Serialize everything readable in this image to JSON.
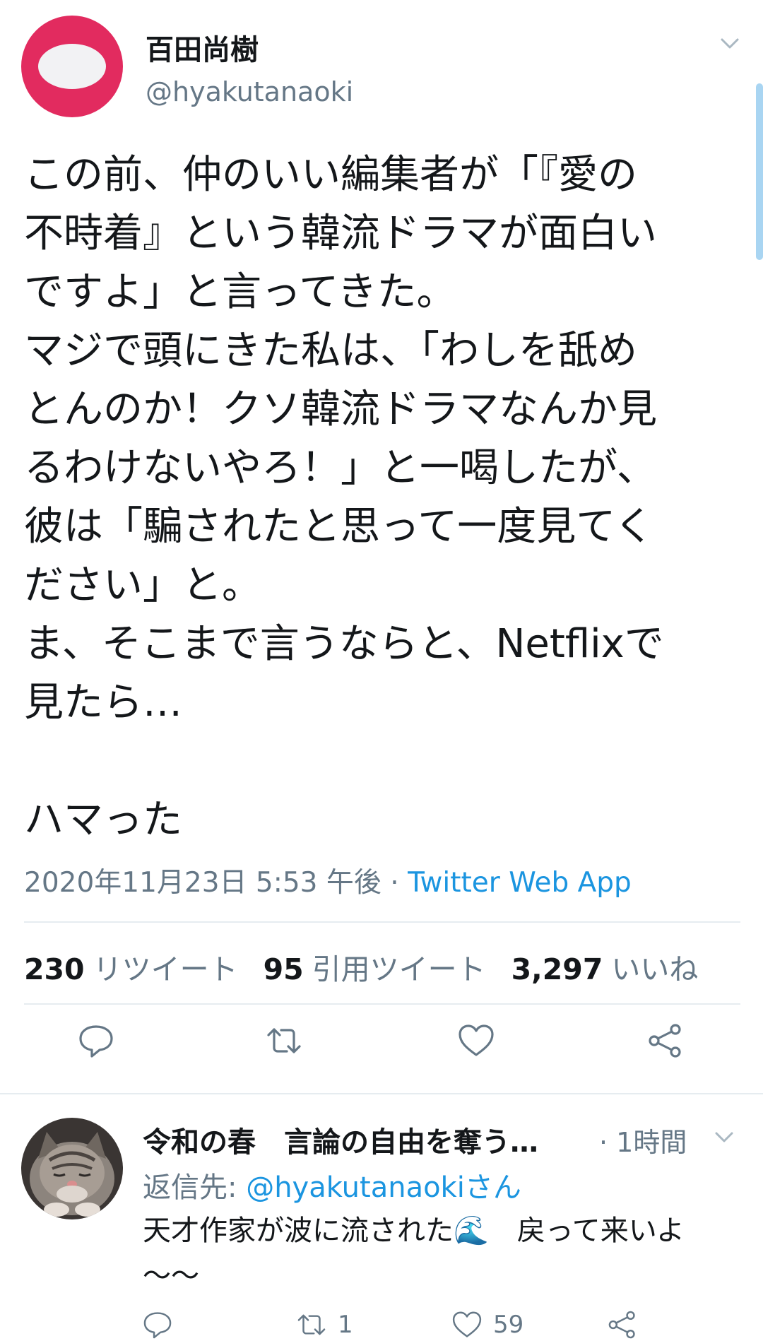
{
  "tweet": {
    "author_name": "百田尚樹",
    "author_handle": "@hyakutanaoki",
    "text": "この前、仲のいい編集者が「『愛の\n不時着』という韓流ドラマが面白い\nですよ」と言ってきた。\nマジで頭にきた私は、「わしを舐め\nとんのか！クソ韓流ドラマなんか見\nるわけないやろ！」と一喝したが、\n彼は「騙されたと思って一度見てく\nださい」と。\nま、そこまで言うならと、Netflixで\n見たら…\n\nハマった",
    "timestamp": "2020年11月23日 5:53 午後",
    "dot": " · ",
    "source": "Twitter Web App",
    "stats": {
      "retweets_count": "230",
      "retweets_label": "リツイート",
      "quotes_count": "95",
      "quotes_label": "引用ツイート",
      "likes_count": "3,297",
      "likes_label": "いいね"
    }
  },
  "reply": {
    "author_name": "令和の春　言論の自由を奪う…",
    "time": "· 1時間",
    "reply_prefix": "返信先: ",
    "reply_mention": "@hyakutanaokiさん",
    "text": "天才作家が波に流された🌊　戻って来いよ\n〜〜",
    "retweet_count": "1",
    "like_count": "59"
  },
  "icons": {
    "reply": "reply-icon",
    "retweet": "retweet-icon",
    "like": "heart-icon",
    "share": "share-icon",
    "caret": "chevron-down-icon"
  },
  "colors": {
    "link": "#1b95e0",
    "muted": "#657786",
    "avatar": "#e22b5f"
  }
}
